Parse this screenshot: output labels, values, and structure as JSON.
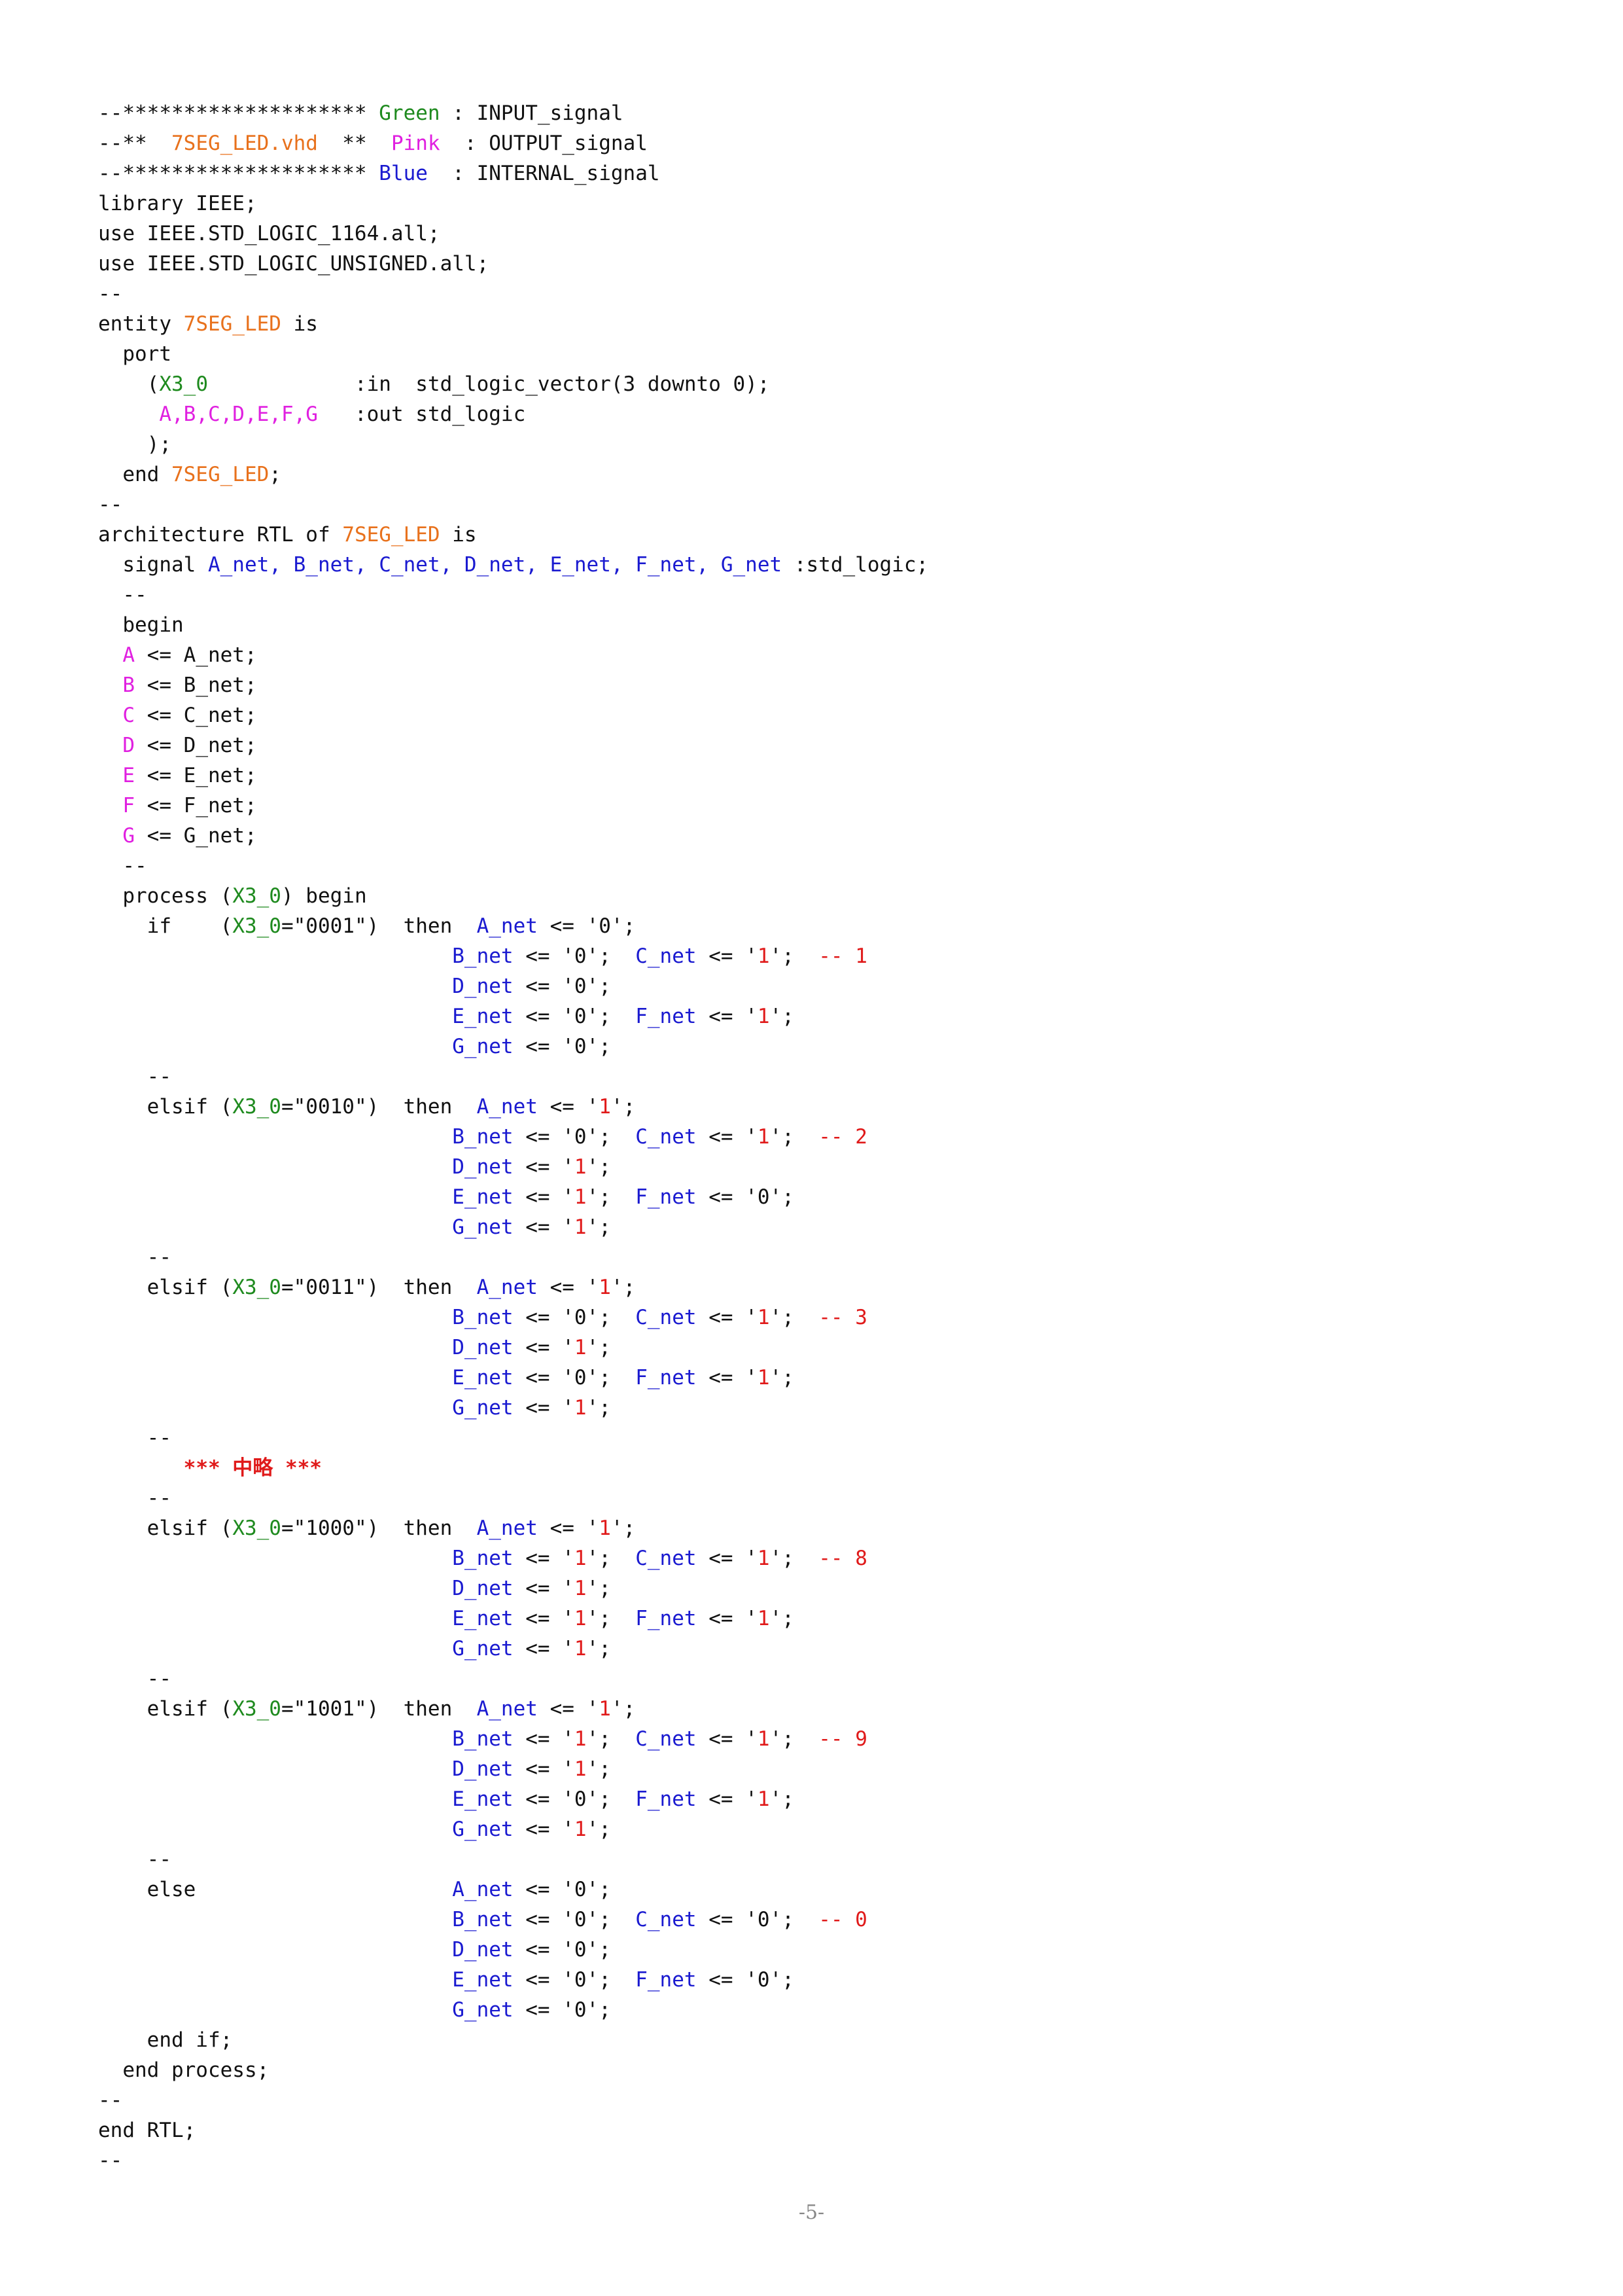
{
  "colors": {
    "input_green": "#1e8a1e",
    "output_pink": "#e020e0",
    "internal_blue": "#1a1ad0",
    "filename_orange": "#e8711c",
    "comment_red": "#e01a1a",
    "text": "#111111"
  },
  "lines": [
    [
      {
        "t": "--******************** "
      },
      {
        "t": "Green",
        "c": "g"
      },
      {
        "t": " : INPUT_signal"
      }
    ],
    [
      {
        "t": "--** "
      },
      {
        "t": " 7SEG_LED.vhd",
        "c": "o"
      },
      {
        "t": "  **  "
      },
      {
        "t": "Pink",
        "c": "p"
      },
      {
        "t": "  : OUTPUT_signal"
      }
    ],
    [
      {
        "t": "--******************** "
      },
      {
        "t": "Blue",
        "c": "b"
      },
      {
        "t": "  : INTERNAL_signal"
      }
    ],
    [
      {
        "t": "library IEEE;"
      }
    ],
    [
      {
        "t": "use IEEE.STD_LOGIC_1164.all;"
      }
    ],
    [
      {
        "t": "use IEEE.STD_LOGIC_UNSIGNED.all;"
      }
    ],
    [
      {
        "t": "--"
      }
    ],
    [
      {
        "t": "entity "
      },
      {
        "t": "7SEG_LED",
        "c": "o"
      },
      {
        "t": " is"
      }
    ],
    [
      {
        "t": "  port"
      }
    ],
    [
      {
        "t": "    ("
      },
      {
        "t": "X3_0",
        "c": "g"
      },
      {
        "t": "            :in  std_logic_vector(3 downto 0);"
      }
    ],
    [
      {
        "t": "     "
      },
      {
        "t": "A,B,C,D,E,F,G",
        "c": "p"
      },
      {
        "t": "   :out std_logic"
      }
    ],
    [
      {
        "t": "    );"
      }
    ],
    [
      {
        "t": "  end "
      },
      {
        "t": "7SEG_LED",
        "c": "o"
      },
      {
        "t": ";"
      }
    ],
    [
      {
        "t": "--"
      }
    ],
    [
      {
        "t": "architecture RTL of "
      },
      {
        "t": "7SEG_LED",
        "c": "o"
      },
      {
        "t": " is"
      }
    ],
    [
      {
        "t": "  signal "
      },
      {
        "t": "A_net, B_net, C_net, D_net, E_net, F_net, G_net",
        "c": "b"
      },
      {
        "t": " :std_logic;"
      }
    ],
    [
      {
        "t": "  --"
      }
    ],
    [
      {
        "t": "  begin"
      }
    ],
    [
      {
        "t": "  "
      },
      {
        "t": "A",
        "c": "p"
      },
      {
        "t": " <= A_net;"
      }
    ],
    [
      {
        "t": "  "
      },
      {
        "t": "B",
        "c": "p"
      },
      {
        "t": " <= B_net;"
      }
    ],
    [
      {
        "t": "  "
      },
      {
        "t": "C",
        "c": "p"
      },
      {
        "t": " <= C_net;"
      }
    ],
    [
      {
        "t": "  "
      },
      {
        "t": "D",
        "c": "p"
      },
      {
        "t": " <= D_net;"
      }
    ],
    [
      {
        "t": "  "
      },
      {
        "t": "E",
        "c": "p"
      },
      {
        "t": " <= E_net;"
      }
    ],
    [
      {
        "t": "  "
      },
      {
        "t": "F",
        "c": "p"
      },
      {
        "t": " <= F_net;"
      }
    ],
    [
      {
        "t": "  "
      },
      {
        "t": "G",
        "c": "p"
      },
      {
        "t": " <= G_net;"
      }
    ],
    [
      {
        "t": "  --"
      }
    ],
    [
      {
        "t": "  process ("
      },
      {
        "t": "X3_0",
        "c": "g"
      },
      {
        "t": ") begin"
      }
    ],
    [
      {
        "t": "    if    ("
      },
      {
        "t": "X3_0",
        "c": "g"
      },
      {
        "t": "=\"0001\")  then  "
      },
      {
        "t": "A_net",
        "c": "b"
      },
      {
        "t": " <= '0';"
      }
    ],
    [
      {
        "t": "                             "
      },
      {
        "t": "B_net",
        "c": "b"
      },
      {
        "t": " <= '0';  "
      },
      {
        "t": "C_net",
        "c": "b"
      },
      {
        "t": " <= '"
      },
      {
        "t": "1",
        "c": "r"
      },
      {
        "t": "';  "
      },
      {
        "t": "-- 1",
        "c": "r"
      }
    ],
    [
      {
        "t": "                             "
      },
      {
        "t": "D_net",
        "c": "b"
      },
      {
        "t": " <= '0';"
      }
    ],
    [
      {
        "t": "                             "
      },
      {
        "t": "E_net",
        "c": "b"
      },
      {
        "t": " <= '0';  "
      },
      {
        "t": "F_net",
        "c": "b"
      },
      {
        "t": " <= '"
      },
      {
        "t": "1",
        "c": "r"
      },
      {
        "t": "';"
      }
    ],
    [
      {
        "t": "                             "
      },
      {
        "t": "G_net",
        "c": "b"
      },
      {
        "t": " <= '0';"
      }
    ],
    [
      {
        "t": "    --"
      }
    ],
    [
      {
        "t": "    elsif ("
      },
      {
        "t": "X3_0",
        "c": "g"
      },
      {
        "t": "=\"0010\")  then  "
      },
      {
        "t": "A_net",
        "c": "b"
      },
      {
        "t": " <= '"
      },
      {
        "t": "1",
        "c": "r"
      },
      {
        "t": "';"
      }
    ],
    [
      {
        "t": "                             "
      },
      {
        "t": "B_net",
        "c": "b"
      },
      {
        "t": " <= '0';  "
      },
      {
        "t": "C_net",
        "c": "b"
      },
      {
        "t": " <= '"
      },
      {
        "t": "1",
        "c": "r"
      },
      {
        "t": "';  "
      },
      {
        "t": "-- 2",
        "c": "r"
      }
    ],
    [
      {
        "t": "                             "
      },
      {
        "t": "D_net",
        "c": "b"
      },
      {
        "t": " <= '"
      },
      {
        "t": "1",
        "c": "r"
      },
      {
        "t": "';"
      }
    ],
    [
      {
        "t": "                             "
      },
      {
        "t": "E_net",
        "c": "b"
      },
      {
        "t": " <= '"
      },
      {
        "t": "1",
        "c": "r"
      },
      {
        "t": "';  "
      },
      {
        "t": "F_net",
        "c": "b"
      },
      {
        "t": " <= '0';"
      }
    ],
    [
      {
        "t": "                             "
      },
      {
        "t": "G_net",
        "c": "b"
      },
      {
        "t": " <= '"
      },
      {
        "t": "1",
        "c": "r"
      },
      {
        "t": "';"
      }
    ],
    [
      {
        "t": "    --"
      }
    ],
    [
      {
        "t": "    elsif ("
      },
      {
        "t": "X3_0",
        "c": "g"
      },
      {
        "t": "=\"0011\")  then  "
      },
      {
        "t": "A_net",
        "c": "b"
      },
      {
        "t": " <= '"
      },
      {
        "t": "1",
        "c": "r"
      },
      {
        "t": "';"
      }
    ],
    [
      {
        "t": "                             "
      },
      {
        "t": "B_net",
        "c": "b"
      },
      {
        "t": " <= '0';  "
      },
      {
        "t": "C_net",
        "c": "b"
      },
      {
        "t": " <= '"
      },
      {
        "t": "1",
        "c": "r"
      },
      {
        "t": "';  "
      },
      {
        "t": "-- 3",
        "c": "r"
      }
    ],
    [
      {
        "t": "                             "
      },
      {
        "t": "D_net",
        "c": "b"
      },
      {
        "t": " <= '"
      },
      {
        "t": "1",
        "c": "r"
      },
      {
        "t": "';"
      }
    ],
    [
      {
        "t": "                             "
      },
      {
        "t": "E_net",
        "c": "b"
      },
      {
        "t": " <= '0';  "
      },
      {
        "t": "F_net",
        "c": "b"
      },
      {
        "t": " <= '"
      },
      {
        "t": "1",
        "c": "r"
      },
      {
        "t": "';"
      }
    ],
    [
      {
        "t": "                             "
      },
      {
        "t": "G_net",
        "c": "b"
      },
      {
        "t": " <= '"
      },
      {
        "t": "1",
        "c": "r"
      },
      {
        "t": "';"
      }
    ],
    [
      {
        "t": "    --"
      }
    ],
    [
      {
        "t": "       "
      },
      {
        "t": "*** 中略 ***",
        "c": "note"
      }
    ],
    [
      {
        "t": "    --"
      }
    ],
    [
      {
        "t": "    elsif ("
      },
      {
        "t": "X3_0",
        "c": "g"
      },
      {
        "t": "=\"1000\")  then  "
      },
      {
        "t": "A_net",
        "c": "b"
      },
      {
        "t": " <= '"
      },
      {
        "t": "1",
        "c": "r"
      },
      {
        "t": "';"
      }
    ],
    [
      {
        "t": "                             "
      },
      {
        "t": "B_net",
        "c": "b"
      },
      {
        "t": " <= '"
      },
      {
        "t": "1",
        "c": "r"
      },
      {
        "t": "';  "
      },
      {
        "t": "C_net",
        "c": "b"
      },
      {
        "t": " <= '"
      },
      {
        "t": "1",
        "c": "r"
      },
      {
        "t": "';  "
      },
      {
        "t": "-- 8",
        "c": "r"
      }
    ],
    [
      {
        "t": "                             "
      },
      {
        "t": "D_net",
        "c": "b"
      },
      {
        "t": " <= '"
      },
      {
        "t": "1",
        "c": "r"
      },
      {
        "t": "';"
      }
    ],
    [
      {
        "t": "                             "
      },
      {
        "t": "E_net",
        "c": "b"
      },
      {
        "t": " <= '"
      },
      {
        "t": "1",
        "c": "r"
      },
      {
        "t": "';  "
      },
      {
        "t": "F_net",
        "c": "b"
      },
      {
        "t": " <= '"
      },
      {
        "t": "1",
        "c": "r"
      },
      {
        "t": "';"
      }
    ],
    [
      {
        "t": "                             "
      },
      {
        "t": "G_net",
        "c": "b"
      },
      {
        "t": " <= '"
      },
      {
        "t": "1",
        "c": "r"
      },
      {
        "t": "';"
      }
    ],
    [
      {
        "t": "    --"
      }
    ],
    [
      {
        "t": "    elsif ("
      },
      {
        "t": "X3_0",
        "c": "g"
      },
      {
        "t": "=\"1001\")  then  "
      },
      {
        "t": "A_net",
        "c": "b"
      },
      {
        "t": " <= '"
      },
      {
        "t": "1",
        "c": "r"
      },
      {
        "t": "';"
      }
    ],
    [
      {
        "t": "                             "
      },
      {
        "t": "B_net",
        "c": "b"
      },
      {
        "t": " <= '"
      },
      {
        "t": "1",
        "c": "r"
      },
      {
        "t": "';  "
      },
      {
        "t": "C_net",
        "c": "b"
      },
      {
        "t": " <= '"
      },
      {
        "t": "1",
        "c": "r"
      },
      {
        "t": "';  "
      },
      {
        "t": "-- 9",
        "c": "r"
      }
    ],
    [
      {
        "t": "                             "
      },
      {
        "t": "D_net",
        "c": "b"
      },
      {
        "t": " <= '"
      },
      {
        "t": "1",
        "c": "r"
      },
      {
        "t": "';"
      }
    ],
    [
      {
        "t": "                             "
      },
      {
        "t": "E_net",
        "c": "b"
      },
      {
        "t": " <= '0';  "
      },
      {
        "t": "F_net",
        "c": "b"
      },
      {
        "t": " <= '"
      },
      {
        "t": "1",
        "c": "r"
      },
      {
        "t": "';"
      }
    ],
    [
      {
        "t": "                             "
      },
      {
        "t": "G_net",
        "c": "b"
      },
      {
        "t": " <= '"
      },
      {
        "t": "1",
        "c": "r"
      },
      {
        "t": "';"
      }
    ],
    [
      {
        "t": "    --"
      }
    ],
    [
      {
        "t": "    else                     "
      },
      {
        "t": "A_net",
        "c": "b"
      },
      {
        "t": " <= '0';"
      }
    ],
    [
      {
        "t": "                             "
      },
      {
        "t": "B_net",
        "c": "b"
      },
      {
        "t": " <= '0';  "
      },
      {
        "t": "C_net",
        "c": "b"
      },
      {
        "t": " <= '0';  "
      },
      {
        "t": "-- 0",
        "c": "r"
      }
    ],
    [
      {
        "t": "                             "
      },
      {
        "t": "D_net",
        "c": "b"
      },
      {
        "t": " <= '0';"
      }
    ],
    [
      {
        "t": "                             "
      },
      {
        "t": "E_net",
        "c": "b"
      },
      {
        "t": " <= '0';  "
      },
      {
        "t": "F_net",
        "c": "b"
      },
      {
        "t": " <= '0';"
      }
    ],
    [
      {
        "t": "                             "
      },
      {
        "t": "G_net",
        "c": "b"
      },
      {
        "t": " <= '0';"
      }
    ],
    [
      {
        "t": "    end if;"
      }
    ],
    [
      {
        "t": "  end process;"
      }
    ],
    [
      {
        "t": "--"
      }
    ],
    [
      {
        "t": "end RTL;"
      }
    ],
    [
      {
        "t": "--"
      }
    ]
  ],
  "footer": {
    "page_number": "-5-"
  }
}
